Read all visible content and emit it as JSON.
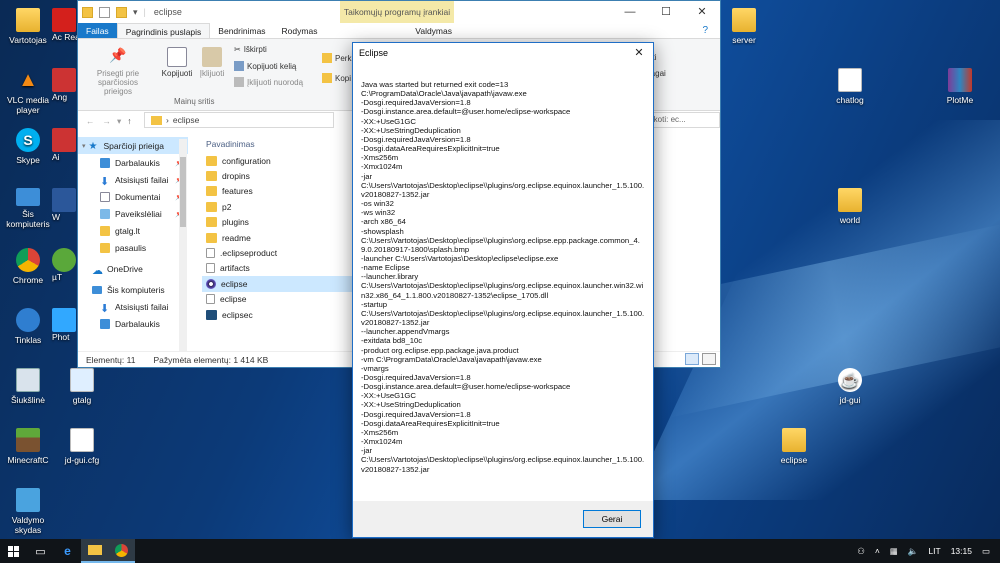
{
  "desktop": {
    "icons_left": [
      {
        "label": "Vartotojas",
        "icon": "user-folder-icon"
      },
      {
        "label": "VLC media player",
        "icon": "vlc-icon"
      },
      {
        "label": "Skype",
        "icon": "skype-icon"
      },
      {
        "label": "Šis kompiuteris",
        "icon": "computer-icon"
      },
      {
        "label": "Chrome",
        "icon": "chrome-icon"
      },
      {
        "label": "Tinklas",
        "icon": "network-icon"
      },
      {
        "label": "Šiukšlinė",
        "icon": "recycle-bin-icon"
      },
      {
        "label": "MinecraftC",
        "icon": "minecraft-icon"
      },
      {
        "label": "Valdymo skydas",
        "icon": "control-panel-icon"
      }
    ],
    "icons_col2": [
      {
        "label": "Ac Rea",
        "icon": "acrobat-icon"
      },
      {
        "label": "Ang",
        "icon": "app-icon"
      },
      {
        "label": "Ai",
        "icon": "app-icon"
      },
      {
        "label": "W",
        "icon": "app-icon"
      },
      {
        "label": "µT",
        "icon": "utorrent-icon"
      },
      {
        "label": "Phot",
        "icon": "photo-icon"
      },
      {
        "label": "gtalg",
        "icon": "image-file-icon"
      },
      {
        "label": "jd-gui.cfg",
        "icon": "file-icon"
      }
    ],
    "icons_right": [
      {
        "label": "server",
        "icon": "folder-icon"
      },
      {
        "label": "chatlog",
        "icon": "file-icon"
      },
      {
        "label": "PlotMe",
        "icon": "archive-icon"
      },
      {
        "label": "world",
        "icon": "folder-icon"
      },
      {
        "label": "jd-gui",
        "icon": "java-icon"
      },
      {
        "label": "eclipse",
        "icon": "folder-icon"
      }
    ]
  },
  "explorer": {
    "title": "eclipse",
    "context_tab": "Taikomųjų programų įrankiai",
    "context_sub": "Valdymas",
    "tabs": [
      "Failas",
      "Pagrindinis puslapis",
      "Bendrinimas",
      "Rodymas"
    ],
    "ribbon": {
      "pin_label": "Prisegti prie sparčiosios prieigos",
      "copy_label": "Kopijuoti",
      "paste_label": "Įklijuoti",
      "cut_label": "Iškirpti",
      "copy_path_label": "Kopijuoti kelią",
      "paste_shortcut_label": "Įklijuoti nuorodą",
      "group_label": "Mainų sritis",
      "move_frag": "Perk",
      "copy_frag": "Kopi",
      "right_frag1": "eti",
      "right_frag2": "ragai"
    },
    "address": "eclipse",
    "search_placeholder": "Ieškoti: ec...",
    "nav": [
      {
        "label": "Sparčioji prieiga",
        "pinned": false
      },
      {
        "label": "Darbalaukis",
        "pinned": true
      },
      {
        "label": "Atsisiųsti failai",
        "pinned": true
      },
      {
        "label": "Dokumentai",
        "pinned": true
      },
      {
        "label": "Paveikslėliai",
        "pinned": true
      },
      {
        "label": "gtalg.lt",
        "pinned": false
      },
      {
        "label": "pasaulis",
        "pinned": false
      },
      {
        "label": "OneDrive",
        "pinned": false
      },
      {
        "label": "Šis kompiuteris",
        "pinned": false
      },
      {
        "label": "Atsisiųsti failai",
        "pinned": false
      },
      {
        "label": "Darbalaukis",
        "pinned": false
      }
    ],
    "column_header": "Pavadinimas",
    "files": [
      {
        "name": "configuration",
        "type": "folder"
      },
      {
        "name": "dropins",
        "type": "folder"
      },
      {
        "name": "features",
        "type": "folder"
      },
      {
        "name": "p2",
        "type": "folder"
      },
      {
        "name": "plugins",
        "type": "folder"
      },
      {
        "name": "readme",
        "type": "folder"
      },
      {
        "name": ".eclipseproduct",
        "type": "file"
      },
      {
        "name": "artifacts",
        "type": "file"
      },
      {
        "name": "eclipse",
        "type": "exe",
        "selected": true
      },
      {
        "name": "eclipse",
        "type": "file"
      },
      {
        "name": "eclipsec",
        "type": "exe"
      }
    ],
    "status": {
      "items": "Elementų: 11",
      "selected": "Pažymėta elementų: 1  414 KB"
    }
  },
  "dialog": {
    "title": "Eclipse",
    "message": "Java was started but returned exit code=13\nC:\\ProgramData\\Oracle\\Java\\javapath\\javaw.exe\n-Dosgi.requiredJavaVersion=1.8\n-Dosgi.instance.area.default=@user.home/eclipse-workspace\n-XX:+UseG1GC\n-XX:+UseStringDeduplication\n-Dosgi.requiredJavaVersion=1.8\n-Dosgi.dataAreaRequiresExplicitInit=true\n-Xms256m\n-Xmx1024m\n-jar\nC:\\Users\\Vartotojas\\Desktop\\eclipse\\\\plugins/org.eclipse.equinox.launcher_1.5.100.v20180827-1352.jar\n-os win32\n-ws win32\n-arch x86_64\n-showsplash\nC:\\Users\\Vartotojas\\Desktop\\eclipse\\\\plugins\\org.eclipse.epp.package.common_4.9.0.20180917-1800\\splash.bmp\n-launcher C:\\Users\\Vartotojas\\Desktop\\eclipse\\eclipse.exe\n-name Eclipse\n--launcher.library\nC:\\Users\\Vartotojas\\Desktop\\eclipse\\\\plugins/org.eclipse.equinox.launcher.win32.win32.x86_64_1.1.800.v20180827-1352\\eclipse_1705.dll\n-startup\nC:\\Users\\Vartotojas\\Desktop\\eclipse\\\\plugins/org.eclipse.equinox.launcher_1.5.100.v20180827-1352.jar\n--launcher.appendVmargs\n-exitdata bd8_10c\n-product org.eclipse.epp.package.java.product\n-vm C:\\ProgramData\\Oracle\\Java\\javapath\\javaw.exe\n-vmargs\n-Dosgi.requiredJavaVersion=1.8\n-Dosgi.instance.area.default=@user.home/eclipse-workspace\n-XX:+UseG1GC\n-XX:+UseStringDeduplication\n-Dosgi.requiredJavaVersion=1.8\n-Dosgi.dataAreaRequiresExplicitInit=true\n-Xms256m\n-Xmx1024m\n-jar\nC:\\Users\\Vartotojas\\Desktop\\eclipse\\\\plugins/org.eclipse.equinox.launcher_1.5.100.v20180827-1352.jar",
    "ok_label": "Gerai"
  },
  "taskbar": {
    "language": "LIT",
    "time": "13:15"
  },
  "colors": {
    "accent": "#1979ca",
    "folder": "#f3c344",
    "selection": "#cce8ff"
  }
}
